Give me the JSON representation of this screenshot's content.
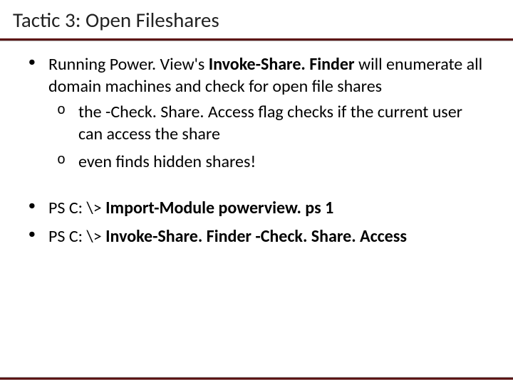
{
  "title": "Tactic 3: Open Fileshares",
  "bullets": {
    "b1": {
      "pre": "Running Power. View's ",
      "bold": "Invoke-Share. Finder",
      "post": " will enumerate all domain machines and check for open file shares"
    },
    "s1": "the -Check. Share. Access flag checks if the current user can access the share",
    "s2": "even finds hidden shares!",
    "b2": {
      "pre": "PS C: \\> ",
      "bold": "Import-Module powerview. ps 1"
    },
    "b3": {
      "pre": "PS C: \\> ",
      "bold": "Invoke-Share. Finder -Check. Share. Access"
    }
  }
}
